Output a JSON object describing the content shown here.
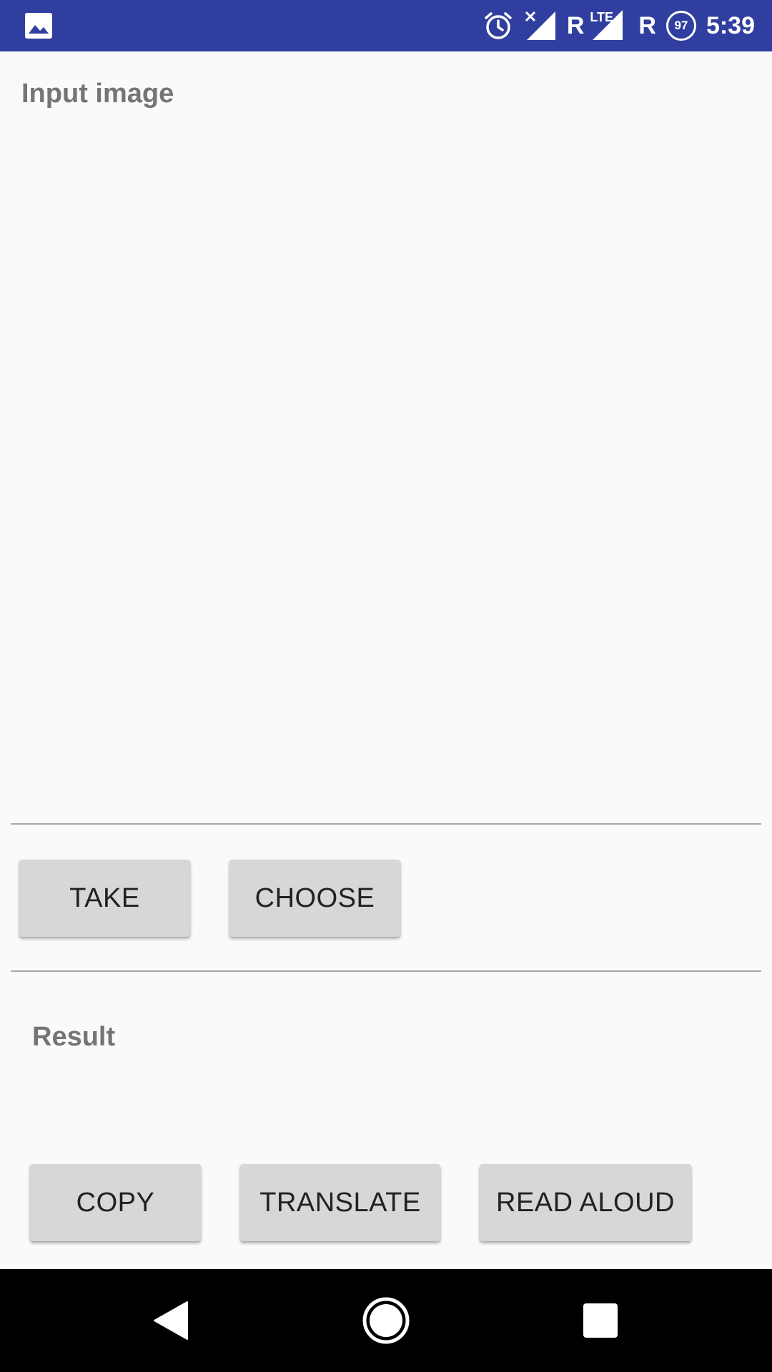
{
  "status_bar": {
    "notification_icon": "image-icon",
    "alarm_icon": "alarm-clock-icon",
    "signal_icon_1": "no-signal-icon",
    "roaming_1": "R",
    "network_type": "LTE",
    "signal_icon_2": "signal-full-icon",
    "roaming_2": "R",
    "battery_level": "97",
    "time": "5:39"
  },
  "main": {
    "input_label": "Input image",
    "result_label": "Result",
    "result_text": ""
  },
  "actions": {
    "take_label": "TAKE",
    "choose_label": "CHOOSE",
    "copy_label": "COPY",
    "translate_label": "TRANSLATE",
    "read_aloud_label": "READ ALOUD"
  },
  "nav_bar": {
    "back_icon": "back-triangle-icon",
    "home_icon": "home-circle-icon",
    "recents_icon": "recents-square-icon"
  },
  "colors": {
    "status_bar": "#303f9f",
    "background": "#fafafa",
    "button": "#d6d7d7",
    "label": "#757575"
  }
}
